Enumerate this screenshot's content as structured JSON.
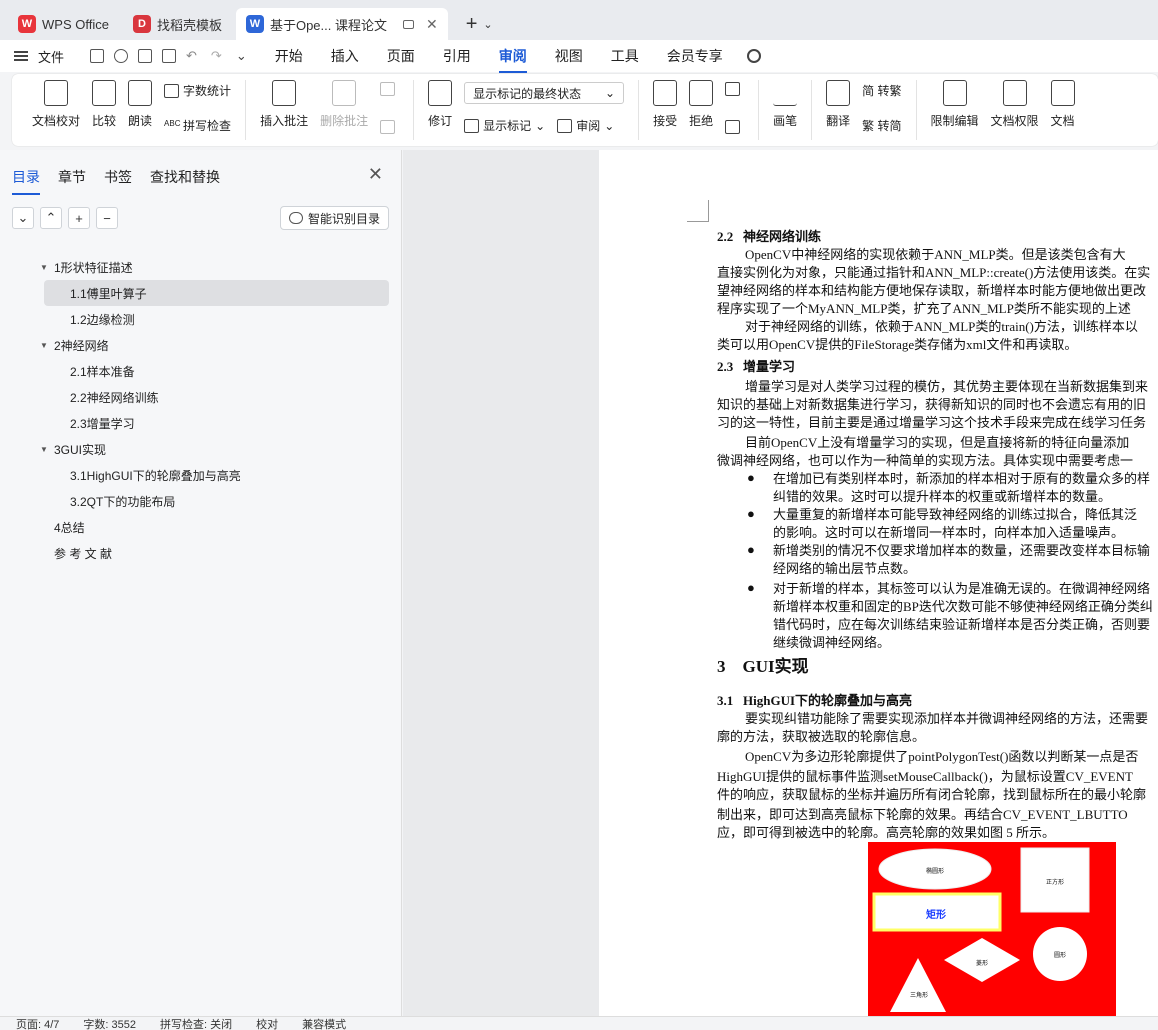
{
  "tabs": [
    {
      "label": "WPS Office",
      "logo_color": "#e8343b",
      "logo": "W"
    },
    {
      "label": "找稻壳模板",
      "logo_color": "#d9363e",
      "logo": "D"
    },
    {
      "label": "基于Ope... 课程论文",
      "logo_color": "#2e67d8",
      "logo": "W",
      "active": true
    }
  ],
  "menu": {
    "file": "文件",
    "items": [
      "开始",
      "插入",
      "页面",
      "引用",
      "审阅",
      "视图",
      "工具",
      "会员专享"
    ],
    "active": "审阅"
  },
  "ribbon": {
    "doc_check": "文档校对",
    "compare": "比较",
    "read_aloud": "朗读",
    "word_count": "字数统计",
    "spell_check": "拼写检查",
    "insert_comment": "插入批注",
    "delete_comment": "删除批注",
    "revise": "修订",
    "markup_select": "显示标记的最终状态",
    "show_markup": "显示标记",
    "review": "审阅",
    "accept": "接受",
    "reject": "拒绝",
    "brush": "画笔",
    "translate": "翻译",
    "to_simplified": "简 转繁",
    "to_traditional": "繁 转简",
    "restrict_edit": "限制编辑",
    "doc_permission": "文档权限",
    "doc_more": "文档"
  },
  "nav": {
    "tabs": [
      "目录",
      "章节",
      "书签",
      "查找和替换"
    ],
    "smart_toc": "智能识别目录",
    "toc": [
      {
        "label": "1形状特征描述",
        "level": 1
      },
      {
        "label": "1.1傅里叶算子",
        "level": 2,
        "selected": true
      },
      {
        "label": "1.2边缘检测",
        "level": 2
      },
      {
        "label": "2神经网络",
        "level": 1
      },
      {
        "label": "2.1样本准备",
        "level": 2
      },
      {
        "label": "2.2神经网络训练",
        "level": 2
      },
      {
        "label": "2.3增量学习",
        "level": 2
      },
      {
        "label": "3GUI实现",
        "level": 1
      },
      {
        "label": "3.1HighGUI下的轮廓叠加与高亮",
        "level": 2
      },
      {
        "label": "3.2QT下的功能布局",
        "level": 2
      },
      {
        "label": "4总结",
        "level": 0
      },
      {
        "label": "参 考 文 献",
        "level": 0
      }
    ]
  },
  "doc": {
    "h_2_2": "2.2   神经网络训练",
    "p1_l1": "OpenCV中神经网络的实现依赖于ANN_MLP类。但是该类包含有大",
    "p1_l2": "直接实例化为对象，只能通过指针和ANN_MLP::create()方法使用该类。在实",
    "p1_l3": "望神经网络的样本和结构能方便地保存读取，新增样本时能方便地做出更改",
    "p1_l4": "程序实现了一个MyANN_MLP类，扩充了ANN_MLP类所不能实现的上述",
    "p2_l1": "对于神经网络的训练，依赖于ANN_MLP类的train()方法，训练样本以",
    "p2_l2": "类可以用OpenCV提供的FileStorage类存储为xml文件和再读取。",
    "h_2_3": "2.3   增量学习",
    "p3_l1": "增量学习是对人类学习过程的模仿，其优势主要体现在当新数据集到来",
    "p3_l2": "知识的基础上对新数据集进行学习，获得新知识的同时也不会遗忘有用的旧",
    "p3_l3": "习的这一特性，目前主要是通过增量学习这个技术手段来完成在线学习任务",
    "p4_l1": "目前OpenCV上没有增量学习的实现，但是直接将新的特征向量添加",
    "p4_l2": "微调神经网络，也可以作为一种简单的实现方法。具体实现中需要考虑一",
    "b1_l1": "在增加已有类别样本时，新添加的样本相对于原有的数量众多的样",
    "b1_l2": "纠错的效果。这时可以提升样本的权重或新增样本的数量。",
    "b2_l1": "大量重复的新增样本可能导致神经网络的训练过拟合，降低其泛",
    "b2_l2": "的影响。这时可以在新增同一样本时，向样本加入适量噪声。",
    "b3_l1": "新增类别的情况不仅要求增加样本的数量，还需要改变样本目标输",
    "b3_l2": "经网络的输出层节点数。",
    "b4_l1": "对于新增的样本，其标签可以认为是准确无误的。在微调神经网络",
    "b4_l2": "新增样本权重和固定的BP迭代次数可能不够使神经网络正确分类纠",
    "b4_l3": "错代码时，应在每次训练结束验证新增样本是否分类正确，否则要",
    "b4_l4": "继续微调神经网络。",
    "h_3": "3    GUI实现",
    "h_3_1": "3.1   HighGUI下的轮廓叠加与高亮",
    "p5_l1": "要实现纠错功能除了需要实现添加样本并微调神经网络的方法，还需要",
    "p5_l2": "廓的方法，获取被选取的轮廓信息。",
    "p6_l1": "OpenCV为多边形轮廓提供了pointPolygonTest()函数以判断某一点是否",
    "p6_l2": "HighGUI提供的鼠标事件监测setMouseCallback()，为鼠标设置CV_EVENT",
    "p6_l3": "件的响应，获取鼠标的坐标并遍历所有闭合轮廓，找到鼠标所在的最小轮廓",
    "p6_l4": "制出来，即可达到高亮鼠标下轮廓的效果。再结合CV_EVENT_LBUTTO",
    "p6_l5": "应，即可得到被选中的轮廓。高亮轮廓的效果如图 5 所示。",
    "bullet": "●"
  },
  "figure": {
    "ellipse": "椭圆形",
    "square": "正方形",
    "rect": "矩形",
    "diamond": "菱形",
    "circle": "圆形",
    "triangle": "三角形",
    "bg_color": "#ff0000",
    "highlight_color": "#ffff66"
  },
  "status": {
    "page": "页面: 4/7",
    "words": "字数: 3552",
    "spell": "拼写检查: 关闭",
    "proof": "校对",
    "compat": "兼容模式"
  }
}
